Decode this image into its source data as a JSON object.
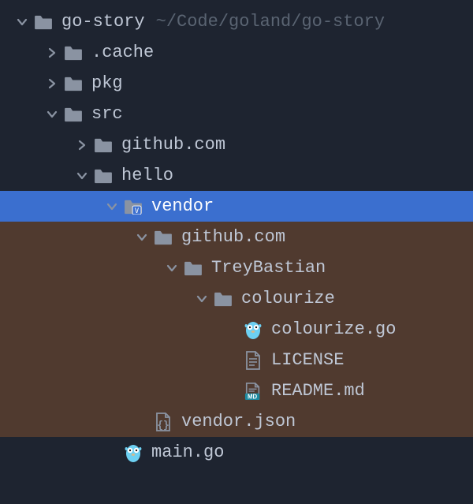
{
  "colors": {
    "bg": "#1e2430",
    "text": "#bfc7d5",
    "selected_bg": "#3b6fcf",
    "highlight_bg": "#503a2f",
    "folder": "#8a93a2",
    "hint": "#5a6472",
    "gopher": "#6dd0f2",
    "badge": "#1d899f"
  },
  "rootHint": "~/Code/goland/go-story",
  "tree": [
    {
      "depth": 0,
      "kind": "folder",
      "expanded": true,
      "label": "go-story",
      "variant": "normal",
      "hint": true
    },
    {
      "depth": 1,
      "kind": "folder",
      "expanded": false,
      "label": ".cache",
      "variant": "normal"
    },
    {
      "depth": 1,
      "kind": "folder",
      "expanded": false,
      "label": "pkg",
      "variant": "normal"
    },
    {
      "depth": 1,
      "kind": "folder",
      "expanded": true,
      "label": "src",
      "variant": "normal"
    },
    {
      "depth": 2,
      "kind": "folder",
      "expanded": false,
      "label": "github.com",
      "variant": "normal"
    },
    {
      "depth": 2,
      "kind": "folder",
      "expanded": true,
      "label": "hello",
      "variant": "normal"
    },
    {
      "depth": 3,
      "kind": "folder",
      "expanded": true,
      "label": "vendor",
      "variant": "badge-v",
      "selected": true
    },
    {
      "depth": 4,
      "kind": "folder",
      "expanded": true,
      "label": "github.com",
      "variant": "normal",
      "highlight": true
    },
    {
      "depth": 5,
      "kind": "folder",
      "expanded": true,
      "label": "TreyBastian",
      "variant": "normal",
      "highlight": true
    },
    {
      "depth": 6,
      "kind": "folder",
      "expanded": true,
      "label": "colourize",
      "variant": "normal",
      "highlight": true
    },
    {
      "depth": 7,
      "kind": "go-file",
      "expanded": null,
      "label": "colourize.go",
      "variant": "go",
      "highlight": true
    },
    {
      "depth": 7,
      "kind": "text-file",
      "expanded": null,
      "label": "LICENSE",
      "variant": "text",
      "highlight": true
    },
    {
      "depth": 7,
      "kind": "md-file",
      "expanded": null,
      "label": "README.md",
      "variant": "md",
      "highlight": true
    },
    {
      "depth": 4,
      "kind": "json-file",
      "expanded": null,
      "label": "vendor.json",
      "variant": "json",
      "highlight": true
    },
    {
      "depth": 3,
      "kind": "go-file",
      "expanded": null,
      "label": "main.go",
      "variant": "go"
    }
  ]
}
